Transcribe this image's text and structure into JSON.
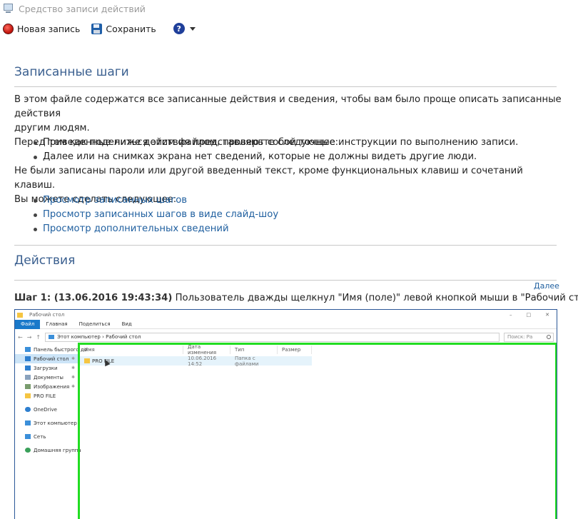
{
  "window": {
    "title": "Средство записи действий"
  },
  "toolbar": {
    "new_record": "Новая запись",
    "save": "Сохранить"
  },
  "recorded": {
    "heading": "Записанные шаги",
    "intro1": "В этом файле содержатся все записанные действия и сведения, чтобы вам было проще описать записанные действия",
    "intro2": "другим людям.",
    "check_intro": "Перед тем как поделиться этим файлом, проверьте следующее:",
    "check_items": [
      "Приведенные ниже действия представляют собой точные инструкции по выполнению записи.",
      "Далее или на снимках экрана нет сведений, которые не должны видеть другие люди."
    ],
    "note": "Не были записаны пароли или другой введенный текст, кроме функциональных клавиш и сочетаний клавиш.",
    "can_do": "Вы можете сделать следующее:",
    "links": [
      "Просмотр записанных шагов",
      "Просмотр записанных шагов в виде слайд-шоу",
      "Просмотр дополнительных сведений"
    ]
  },
  "actions": {
    "heading": "Действия",
    "next": "Далее",
    "step_label": "Шаг 1: (13.06.2016 19:43:34)",
    "step_text": " Пользователь дважды щелкнул \"Имя (поле)\" левой кнопкой мыши в \"Рабочий стол\""
  },
  "explorer": {
    "title": "Рабочий стол",
    "ribbon": {
      "file": "Файл",
      "tabs": [
        "Главная",
        "Поделиться",
        "Вид"
      ]
    },
    "address": "Этот компьютер › Рабочий стол",
    "search_placeholder": "Поиск: Ра",
    "sidebar": {
      "quick_access": "Панель быстрого до",
      "items": [
        "Рабочий стол",
        "Загрузки",
        "Документы",
        "Изображения",
        "PRO FILE"
      ],
      "onedrive": "OneDrive",
      "this_pc": "Этот компьютер",
      "network": "Сеть",
      "homegroup": "Домашняя группа"
    },
    "columns": [
      "Имя",
      "Дата изменения",
      "Тип",
      "Размер"
    ],
    "row": {
      "name": "PRO FILE",
      "date": "10.06.2016 14:52",
      "type": "Папка с файлами",
      "size": ""
    }
  }
}
